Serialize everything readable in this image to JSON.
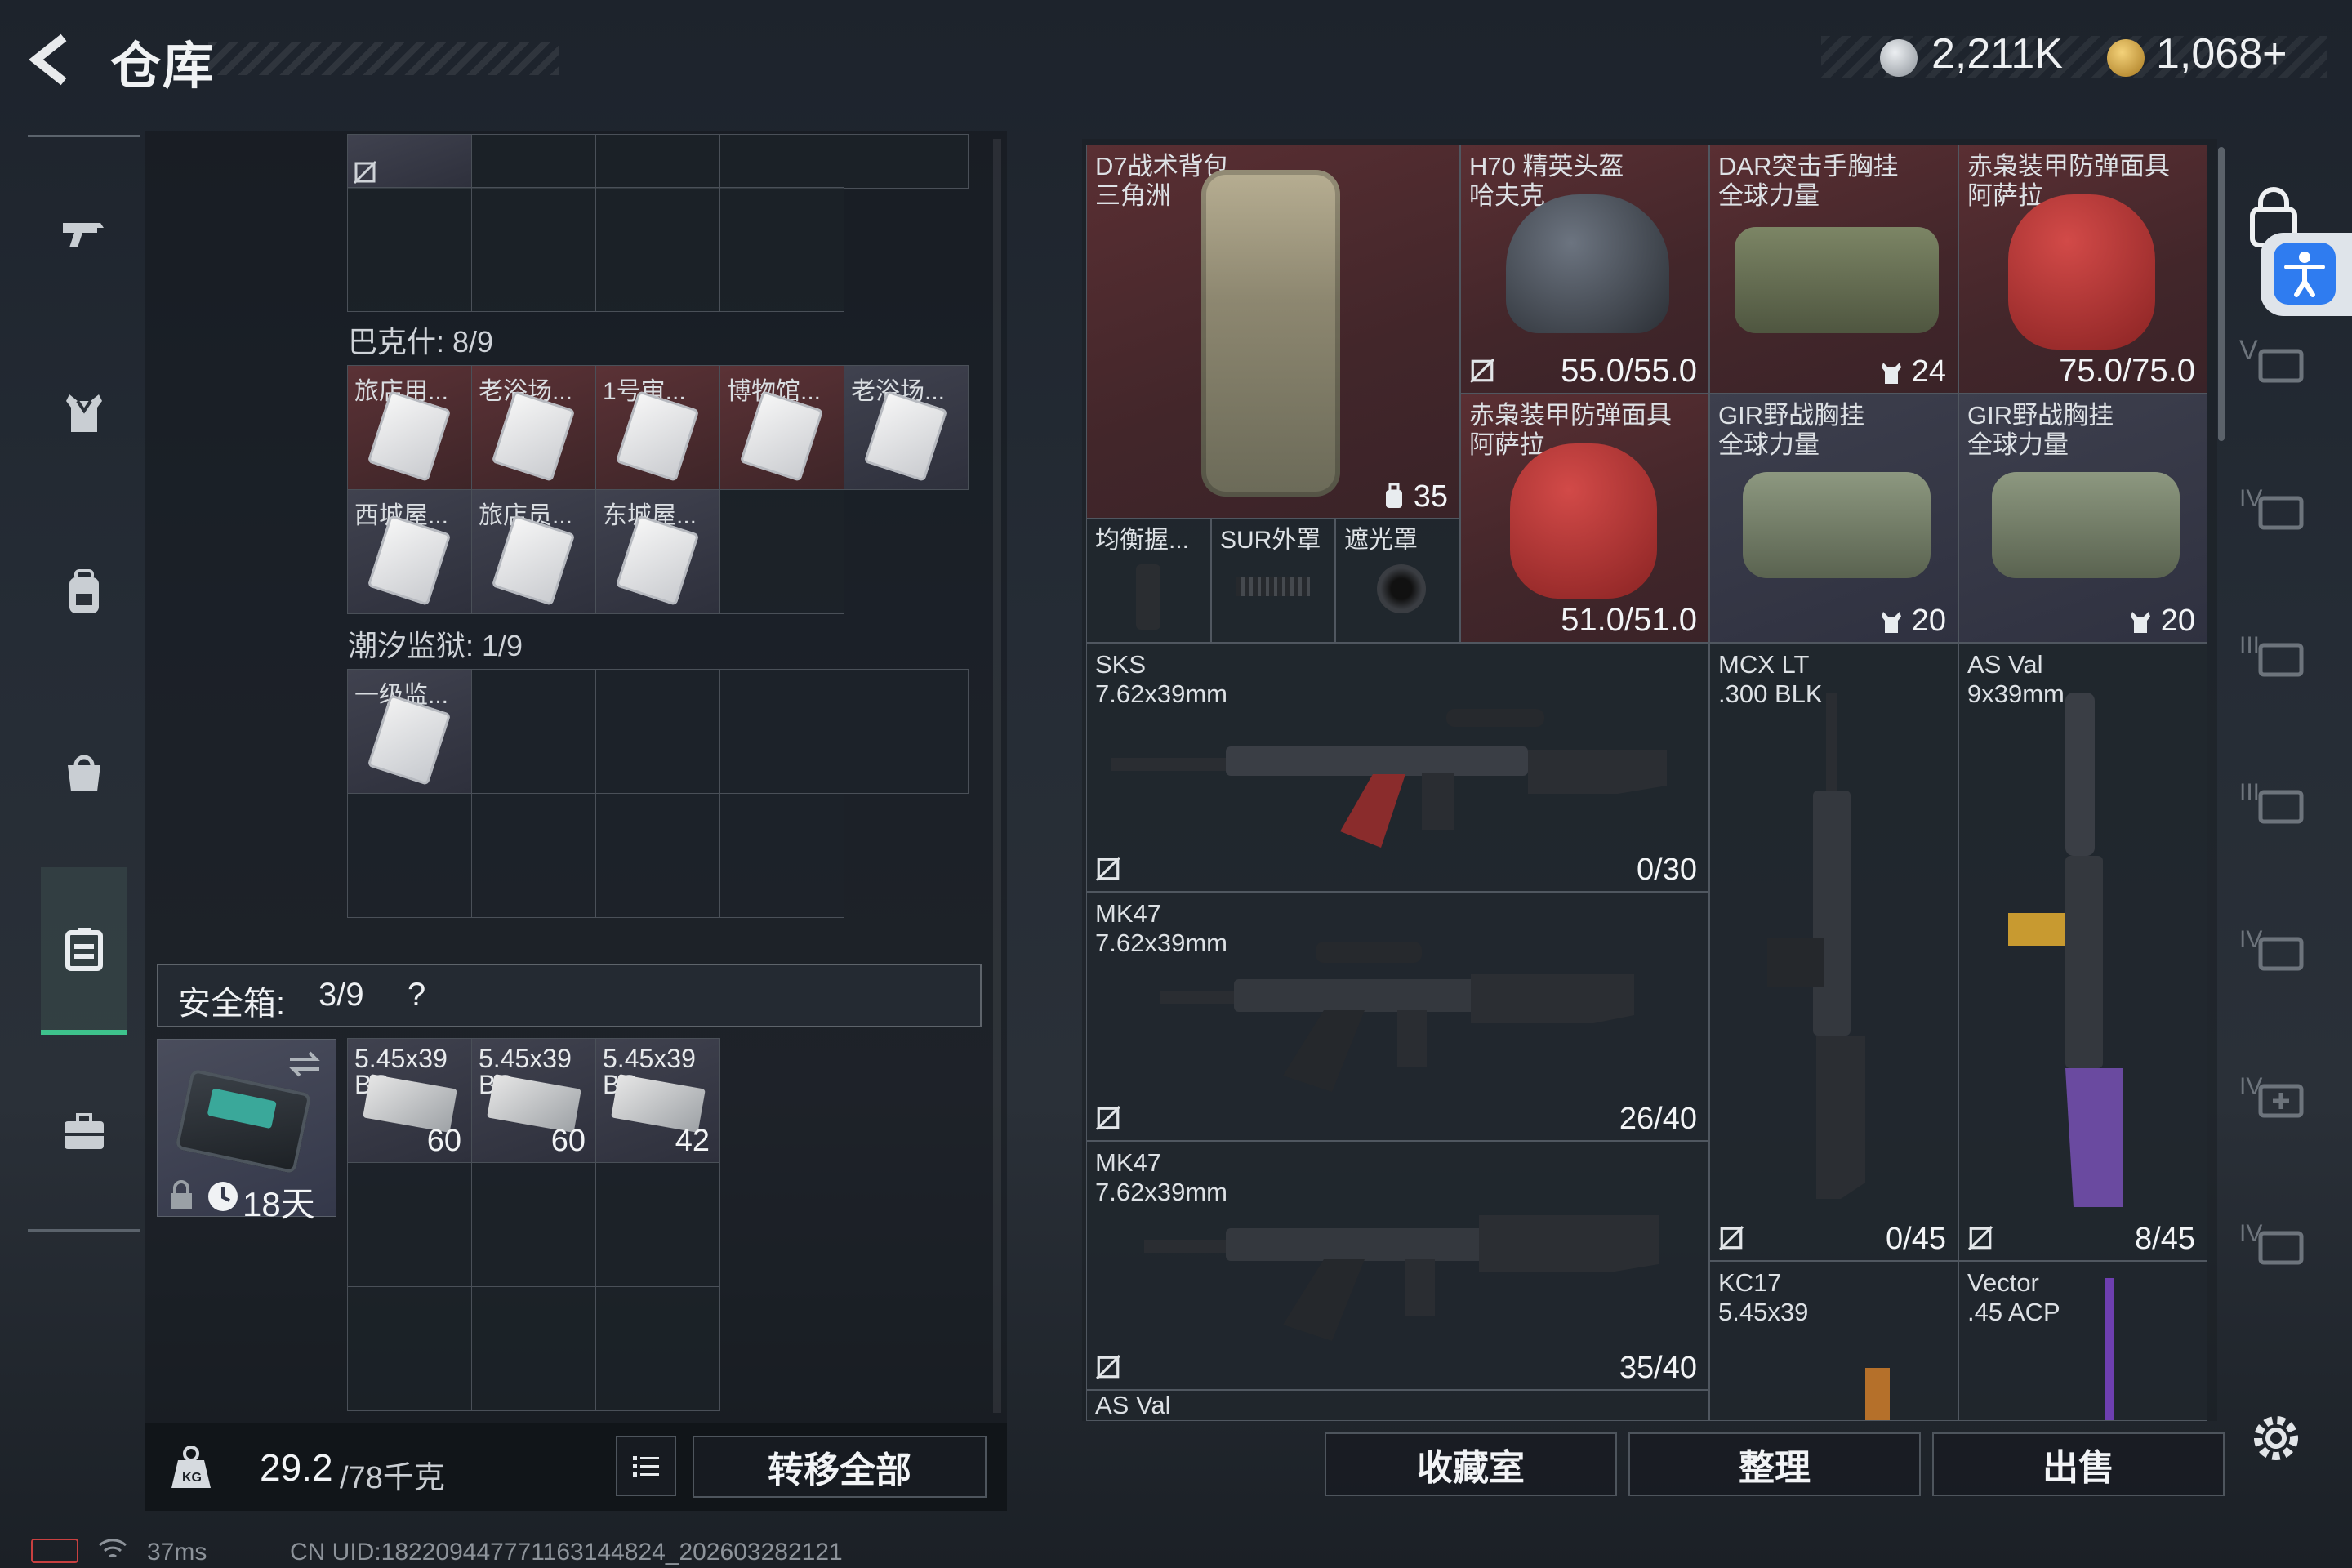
{
  "header": {
    "title": "仓库",
    "currency_silver": "2,211K",
    "currency_gold": "1,068+"
  },
  "left": {
    "section_bakesh": "巴克什: 8/9",
    "bakesh_items": [
      "旅店用...",
      "老浴场...",
      "1号审...",
      "博物馆...",
      "老浴场...",
      "西城屋...",
      "旅店员...",
      "东城屋..."
    ],
    "section_prison": "潮汐监狱: 1/9",
    "prison_items": [
      "一级监..."
    ],
    "safebox_label": "安全箱:",
    "safebox_count": "3/9",
    "safebox_help": "?",
    "safebox_timer": "18天",
    "ammo": [
      {
        "name": "5.45x39",
        "sub": "BS",
        "count": "60"
      },
      {
        "name": "5.45x39",
        "sub": "BS",
        "count": "60"
      },
      {
        "name": "5.45x39",
        "sub": "BS",
        "count": "42"
      }
    ],
    "weight_current": "29.2",
    "weight_max": "/78千克",
    "transfer_all": "转移全部"
  },
  "stash": {
    "backpack": {
      "name": "D7战术背包\n三角洲",
      "value": "35"
    },
    "helmet": {
      "name": "H70 精英头盔\n哈夫克",
      "durability": "55.0/55.0"
    },
    "rig_dar": {
      "name": "DAR突击手胸挂\n全球力量",
      "value": "24"
    },
    "mask1": {
      "name": "赤枭装甲防弹面具\n阿萨拉",
      "durability": "75.0/75.0"
    },
    "attach1": "均衡握...",
    "attach2": "SUR外罩",
    "attach3": "遮光罩",
    "mask2": {
      "name": "赤枭装甲防弹面具\n阿萨拉",
      "durability": "51.0/51.0"
    },
    "rig_gir1": {
      "name": "GIR野战胸挂\n全球力量",
      "value": "20"
    },
    "rig_gir2": {
      "name": "GIR野战胸挂\n全球力量",
      "value": "20"
    },
    "sks": {
      "name": "SKS\n7.62x39mm",
      "ammo": "0/30"
    },
    "mcx": {
      "name": "MCX LT\n.300 BLK",
      "ammo": "0/45"
    },
    "asval": {
      "name": "AS Val\n9x39mm",
      "ammo": "8/45"
    },
    "mk47a": {
      "name": "MK47\n7.62x39mm",
      "ammo": "26/40"
    },
    "mk47b": {
      "name": "MK47\n7.62x39mm",
      "ammo": "35/40"
    },
    "kc17": {
      "name": "KC17\n5.45x39"
    },
    "vector": {
      "name": "Vector\n.45 ACP"
    },
    "asval2": {
      "name": "AS Val"
    }
  },
  "buttons": {
    "collection": "收藏室",
    "sort": "整理",
    "sell": "出售"
  },
  "status": {
    "ping": "37ms",
    "uid": "CN UID:182209447771163144824_202603282121"
  },
  "colors": {
    "active_tab": "#3ec28c",
    "red_rarity": "#5a2f33",
    "blue_rarity": "#3d3f4d"
  }
}
